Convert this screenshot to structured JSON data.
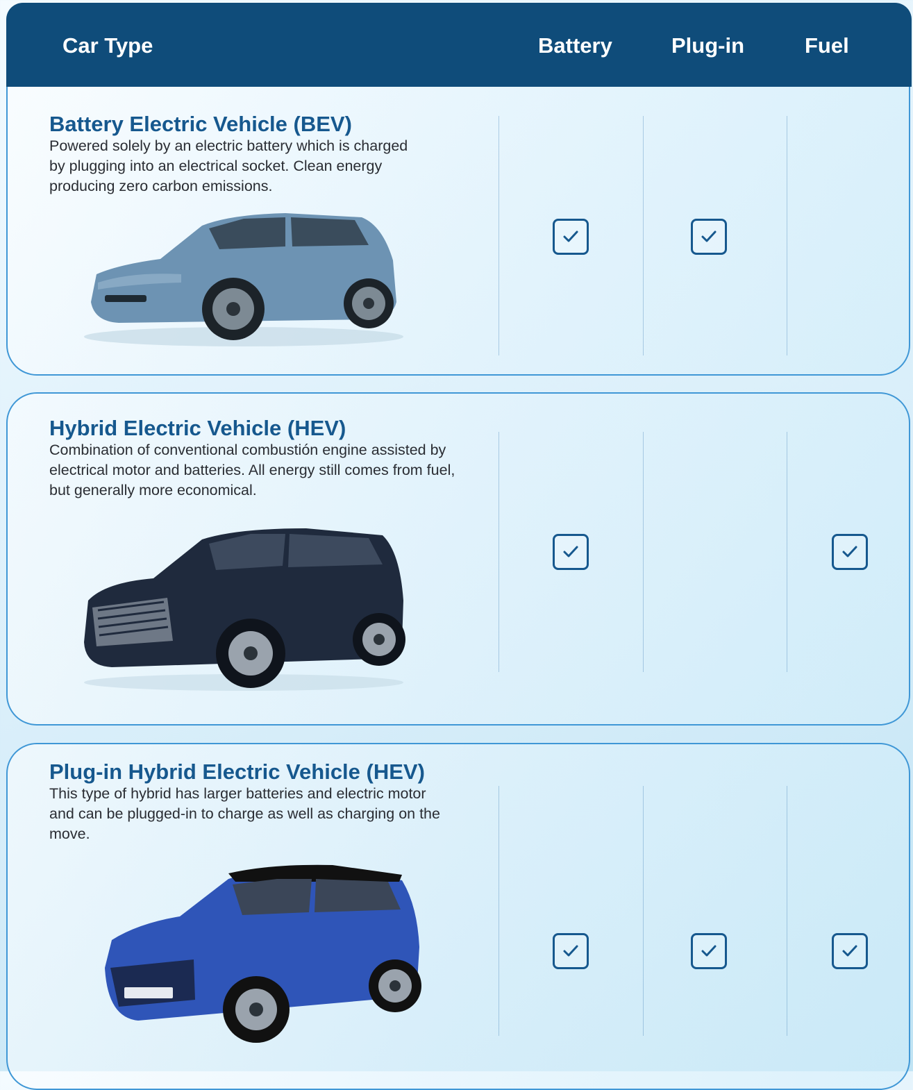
{
  "header": {
    "car_type": "Car Type",
    "battery": "Battery",
    "plug_in": "Plug-in",
    "fuel": "Fuel"
  },
  "rows": [
    {
      "title": "Battery Electric Vehicle (BEV)",
      "description": "Powered solely by an electric battery which is charged by plugging into an electrical socket. Clean energy producing zero carbon emissions.",
      "battery": true,
      "plug_in": true,
      "fuel": false,
      "car_color": "#6d93b3"
    },
    {
      "title": "Hybrid Electric Vehicle (HEV)",
      "description": "Combination of conventional combustión engine assisted by electrical motor and batteries. All energy still comes from fuel, but generally more economical.",
      "battery": true,
      "plug_in": false,
      "fuel": true,
      "car_color": "#1f2a3d"
    },
    {
      "title": "Plug-in Hybrid Electric Vehicle (HEV)",
      "description": "This type of hybrid has larger batteries and electric motor and can be plugged-in to charge as well as charging on the move.",
      "battery": true,
      "plug_in": true,
      "fuel": true,
      "car_color": "#2f55b8"
    }
  ],
  "colors": {
    "header_bg": "#0f4c7a",
    "title": "#16588e",
    "card_border": "#3f97d6",
    "check": "#16588e"
  },
  "icons": {
    "check": "checkbox-checked-icon"
  }
}
